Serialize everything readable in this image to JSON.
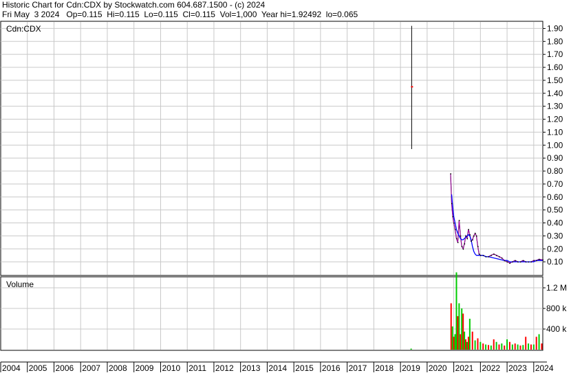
{
  "header": {
    "title": "Historic Chart for Cdn:CDX by Stockwatch.com 604.687.1500 - (c) 2024",
    "quote_line": "Fri May  3 2024   Op=0.115  Hi=0.115  Lo=0.115  Cl=0.115  Vol=1,000  Year hi=1.92492  lo=0.065"
  },
  "chart_data": [
    {
      "type": "line",
      "panel_label": "Cdn:CDX",
      "ylim": [
        0.0,
        1.95
      ],
      "y_ticks": [
        0.1,
        0.2,
        0.3,
        0.4,
        0.5,
        0.6,
        0.7,
        0.8,
        0.9,
        1.0,
        1.1,
        1.2,
        1.3,
        1.4,
        1.5,
        1.6,
        1.7,
        1.8,
        1.9
      ],
      "y_tick_labels": [
        "0.10",
        "0.20",
        "0.30",
        "0.40",
        "0.50",
        "0.60",
        "0.70",
        "0.80",
        "0.90",
        "1.00",
        "1.10",
        "1.20",
        "1.30",
        "1.40",
        "1.50",
        "1.60",
        "1.70",
        "1.80",
        "1.90"
      ],
      "grid": true,
      "colors": {
        "price": "#000000",
        "ma_short": "#ff00ff",
        "ma_long": "#0000ff",
        "spike": "#ff0000"
      },
      "x": [
        2019.4,
        2019.42,
        2019.44,
        2020.88,
        2020.92,
        2020.96,
        2021.0,
        2021.05,
        2021.1,
        2021.15,
        2021.2,
        2021.25,
        2021.3,
        2021.35,
        2021.4,
        2021.45,
        2021.5,
        2021.55,
        2021.6,
        2021.65,
        2021.7,
        2021.75,
        2021.8,
        2021.85,
        2021.9,
        2021.95,
        2022.0,
        2022.1,
        2022.2,
        2022.3,
        2022.4,
        2022.5,
        2022.6,
        2022.7,
        2022.8,
        2022.9,
        2023.0,
        2023.1,
        2023.2,
        2023.3,
        2023.4,
        2023.5,
        2023.6,
        2023.7,
        2023.8,
        2023.9,
        2024.0,
        2024.1,
        2024.2,
        2024.34
      ],
      "series": [
        {
          "values": [
            1.2,
            1.45,
            1.6,
            0.78,
            0.55,
            0.45,
            0.4,
            0.35,
            0.28,
            0.25,
            0.42,
            0.3,
            0.22,
            0.2,
            0.24,
            0.3,
            0.28,
            0.35,
            0.31,
            0.26,
            0.27,
            0.3,
            0.32,
            0.3,
            0.22,
            0.16,
            0.15,
            0.15,
            0.14,
            0.14,
            0.15,
            0.16,
            0.15,
            0.14,
            0.13,
            0.11,
            0.1,
            0.09,
            0.1,
            0.11,
            0.1,
            0.1,
            0.11,
            0.1,
            0.1,
            0.1,
            0.11,
            0.11,
            0.12,
            0.115
          ]
        }
      ],
      "ma_long_values": [
        0.62,
        0.52,
        0.45,
        0.4,
        0.35,
        0.32,
        0.3,
        0.28,
        0.27,
        0.27,
        0.28,
        0.29,
        0.3,
        0.31,
        0.3,
        0.27,
        0.22,
        0.18,
        0.16,
        0.15,
        0.15,
        0.15,
        0.15,
        0.15,
        0.14,
        0.14,
        0.13,
        0.12,
        0.11,
        0.11,
        0.1,
        0.1,
        0.1,
        0.1,
        0.1,
        0.1,
        0.11,
        0.11,
        0.11
      ],
      "ma_long_x": [
        2020.92,
        2020.96,
        2021.0,
        2021.05,
        2021.1,
        2021.15,
        2021.2,
        2021.25,
        2021.3,
        2021.35,
        2021.4,
        2021.45,
        2021.5,
        2021.55,
        2021.6,
        2021.65,
        2021.7,
        2021.75,
        2021.8,
        2021.85,
        2021.9,
        2021.95,
        2022.0,
        2022.1,
        2022.2,
        2022.3,
        2022.5,
        2022.7,
        2022.9,
        2023.0,
        2023.1,
        2023.2,
        2023.4,
        2023.6,
        2023.8,
        2024.0,
        2024.1,
        2024.2,
        2024.34
      ],
      "spike_range": {
        "x": 2019.42,
        "low": 0.97,
        "high": 1.92
      }
    },
    {
      "type": "bar",
      "panel_label": "Volume",
      "ylim": [
        0,
        1400000
      ],
      "y_ticks": [
        400000,
        800000,
        1200000
      ],
      "y_tick_labels": [
        "400 k",
        "800 k",
        "1.2 M"
      ],
      "grid": true,
      "colors": {
        "up": "#00cc00",
        "down": "#ff0000"
      },
      "x": [
        2019.4,
        2020.9,
        2020.95,
        2021.0,
        2021.05,
        2021.1,
        2021.15,
        2021.2,
        2021.25,
        2021.3,
        2021.35,
        2021.4,
        2021.45,
        2021.5,
        2021.55,
        2021.6,
        2021.7,
        2021.8,
        2021.9,
        2022.0,
        2022.1,
        2022.2,
        2022.3,
        2022.4,
        2022.5,
        2022.6,
        2022.7,
        2022.8,
        2022.9,
        2023.0,
        2023.1,
        2023.2,
        2023.3,
        2023.4,
        2023.5,
        2023.6,
        2023.7,
        2023.8,
        2023.9,
        2024.0,
        2024.1,
        2024.2,
        2024.3
      ],
      "values": [
        20000,
        900000,
        450000,
        250000,
        300000,
        1500000,
        650000,
        900000,
        300000,
        800000,
        700000,
        350000,
        200000,
        150000,
        250000,
        600000,
        350000,
        180000,
        220000,
        150000,
        120000,
        100000,
        90000,
        80000,
        200000,
        150000,
        100000,
        120000,
        80000,
        200000,
        150000,
        100000,
        120000,
        100000,
        80000,
        90000,
        250000,
        120000,
        100000,
        100000,
        250000,
        300000,
        120000
      ],
      "up": [
        true,
        false,
        true,
        false,
        true,
        true,
        false,
        true,
        false,
        true,
        false,
        true,
        false,
        true,
        false,
        true,
        false,
        true,
        false,
        true,
        false,
        true,
        false,
        true,
        false,
        true,
        false,
        true,
        false,
        true,
        false,
        true,
        false,
        true,
        false,
        true,
        false,
        true,
        false,
        true,
        false,
        true,
        false
      ]
    }
  ],
  "x_axis": {
    "years": [
      "2004",
      "2005",
      "2006",
      "2007",
      "2008",
      "2009",
      "2010",
      "2011",
      "2012",
      "2013",
      "2014",
      "2015",
      "2016",
      "2017",
      "2018",
      "2019",
      "2020",
      "2021",
      "2022",
      "2023",
      "2024"
    ]
  }
}
